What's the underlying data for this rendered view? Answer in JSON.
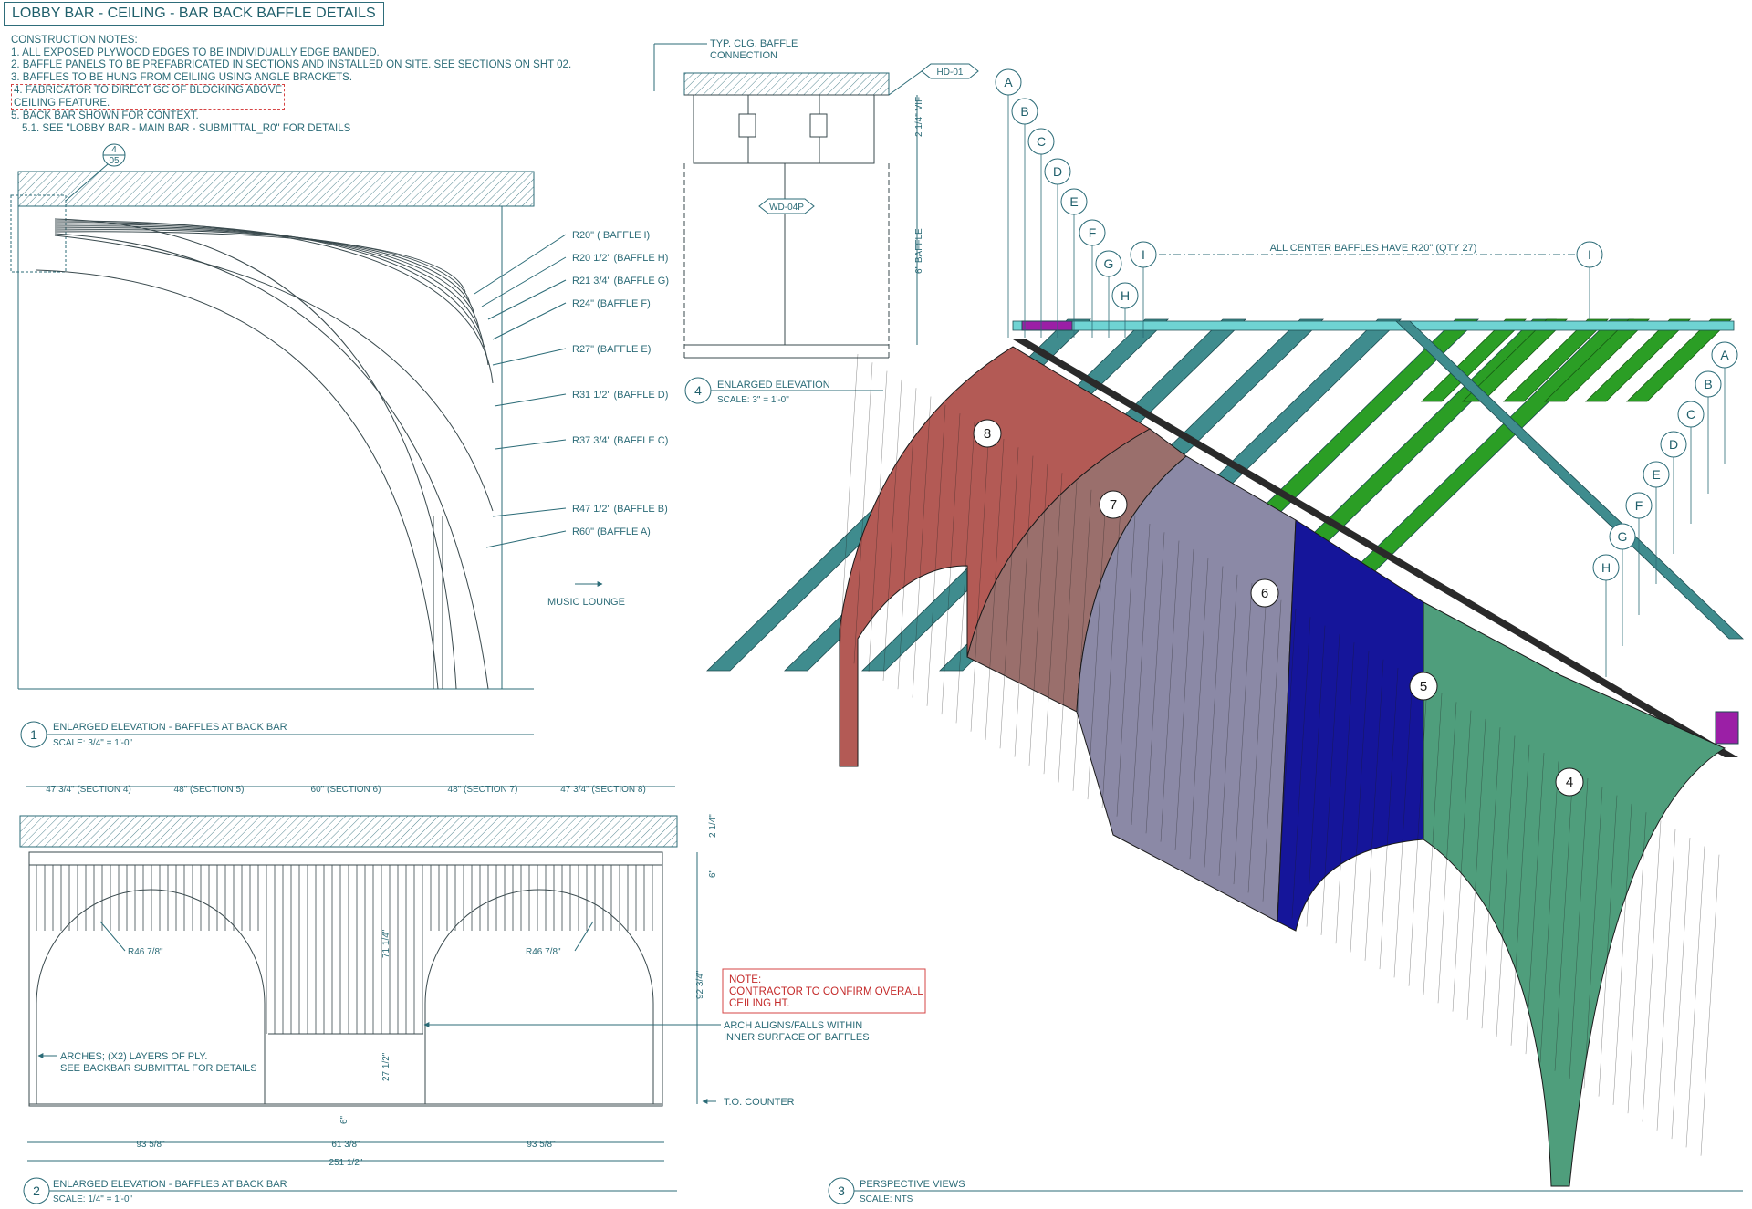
{
  "title": "LOBBY BAR - CEILING - BAR BACK BAFFLE DETAILS",
  "notes": {
    "heading": "CONSTRUCTION NOTES:",
    "n1": "1. ALL EXPOSED PLYWOOD EDGES TO BE INDIVIDUALLY EDGE BANDED.",
    "n2": "2. BAFFLE PANELS TO BE PREFABRICATED IN SECTIONS AND INSTALLED ON SITE. SEE SECTIONS ON SHT 02.",
    "n3": "3. BAFFLES TO BE HUNG FROM CEILING USING ANGLE BRACKETS.",
    "n4a": "4. FABRICATOR TO DIRECT GC OF BLOCKING ABOVE",
    "n4b": "CEILING FEATURE.",
    "n5": "5. BACK BAR SHOWN FOR CONTEXT.",
    "n51": "5.1. SEE \"LOBBY BAR - MAIN BAR - SUBMITTAL_R0\" FOR DETAILS"
  },
  "detail1": {
    "ref_top": "4",
    "ref_bottom": "05",
    "radii": [
      "R20\" ( BAFFLE I)",
      "R20 1/2\" (BAFFLE H)",
      "R21 3/4\" (BAFFLE G)",
      "R24\" (BAFFLE F)",
      "R27\" (BAFFLE E)",
      "R31 1/2\" (BAFFLE D)",
      "R37 3/4\" (BAFFLE C)",
      "R47 1/2\" (BAFFLE B)",
      "R60\" (BAFFLE A)"
    ],
    "music_lounge": "MUSIC LOUNGE",
    "number": "1",
    "title": "ENLARGED ELEVATION - BAFFLES AT BACK BAR",
    "scale": "SCALE: 3/4\" = 1'-0\""
  },
  "detail4": {
    "typ": "TYP. CLG. BAFFLE",
    "connection": "CONNECTION",
    "hd": "HD-01",
    "wd": "WD-04P",
    "dim_vif": "2 1/4\" VIF",
    "dim_baffle": "6\" BAFFLE",
    "number": "4",
    "title": "ENLARGED ELEVATION",
    "scale": "SCALE: 3\" = 1'-0\""
  },
  "detail2": {
    "sections": [
      "47 3/4\" (SECTION 4)",
      "48\" (SECTION 5)",
      "60\" (SECTION 6)",
      "48\" (SECTION 7)",
      "47 3/4\" (SECTION 8)"
    ],
    "r_left": "R46 7/8\"",
    "r_right": "R46 7/8\"",
    "dim_71": "71 1/4\"",
    "dim_27": "27 1/2\"",
    "dim_92": "92 3/4\"",
    "dim_2_14": "2 1/4\"",
    "dim_6": "6\"",
    "dim_6b": "6\"",
    "bottom_dims": [
      "93 5/8\"",
      "61 3/8\"",
      "93 5/8\""
    ],
    "total": "251 1/2\"",
    "note_title": "NOTE:",
    "note_l1": "CONTRACTOR TO CONFIRM OVERALL",
    "note_l2": "CEILING HT.",
    "arch_note_l1": "ARCH ALIGNS/FALLS WITHIN",
    "arch_note_l2": "INNER SURFACE OF BAFFLES",
    "arches_l1": "ARCHES; (X2) LAYERS OF PLY.",
    "arches_l2": "SEE BACKBAR SUBMITTAL FOR DETAILS",
    "counter": "T.O. COUNTER",
    "number": "2",
    "title": "ENLARGED ELEVATION - BAFFLES AT BACK BAR",
    "scale": "SCALE: 1/4\" = 1'-0\""
  },
  "detail3": {
    "baffle_letters": [
      "A",
      "B",
      "C",
      "D",
      "E",
      "F",
      "G",
      "H",
      "I"
    ],
    "center_note": "ALL CENTER BAFFLES HAVE R20\" (QTY 27)",
    "right_letters": [
      "A",
      "B",
      "C",
      "D",
      "E",
      "F",
      "G",
      "H"
    ],
    "sections": [
      "8",
      "7",
      "6",
      "5",
      "4"
    ],
    "number": "3",
    "title": "PERSPECTIVE VIEWS",
    "scale": "SCALE: NTS"
  },
  "colors": {
    "line": "#2b6b77",
    "section8": "#b35a55",
    "section7": "#9a6f6c",
    "section6": "#8b89a6",
    "section5": "#15159a",
    "section4": "#4f9e7c",
    "joist_teal": "#3f8c8e",
    "joist_green": "#2b9e25",
    "joist_purple": "#9b1fa6",
    "frame_cyan": "#6fd3d3",
    "note_red": "#c42a2a"
  }
}
